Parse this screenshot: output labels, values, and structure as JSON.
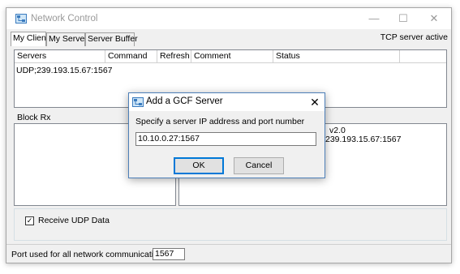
{
  "window": {
    "title": "Network Control",
    "controls": {
      "minimize": "—",
      "maximize": "☐",
      "close": "✕"
    }
  },
  "tabs": [
    {
      "label": "My Client",
      "active": true
    },
    {
      "label": "My Server",
      "active": false
    },
    {
      "label": "Server Buffer",
      "active": false
    }
  ],
  "tcp_status": "TCP server active",
  "server_list": {
    "columns": [
      "Servers",
      "Command",
      "Refresh",
      "Comment",
      "Status"
    ],
    "rows": [
      {
        "server": "UDP;239.193.15.67:1567"
      }
    ]
  },
  "block_rx": {
    "label": "Block Rx"
  },
  "right_panel": {
    "line1": "v2.0",
    "line2": "239.193.15.67:1567"
  },
  "receive_udp": {
    "label": "Receive UDP Data",
    "checked": true,
    "mark": "✓"
  },
  "footer": {
    "port_label": "Port used for all network communications:",
    "port_value": "1567"
  },
  "dialog": {
    "title": "Add a GCF Server",
    "close": "✕",
    "prompt": "Specify a server IP address and port number",
    "input_value": "10.10.0.27:1567",
    "ok_label": "OK",
    "cancel_label": "Cancel"
  },
  "colors": {
    "accent": "#0078d7",
    "dialog_border": "#4d7fb8"
  },
  "icons": {
    "app": "network-app-icon",
    "dialog": "network-app-icon"
  }
}
